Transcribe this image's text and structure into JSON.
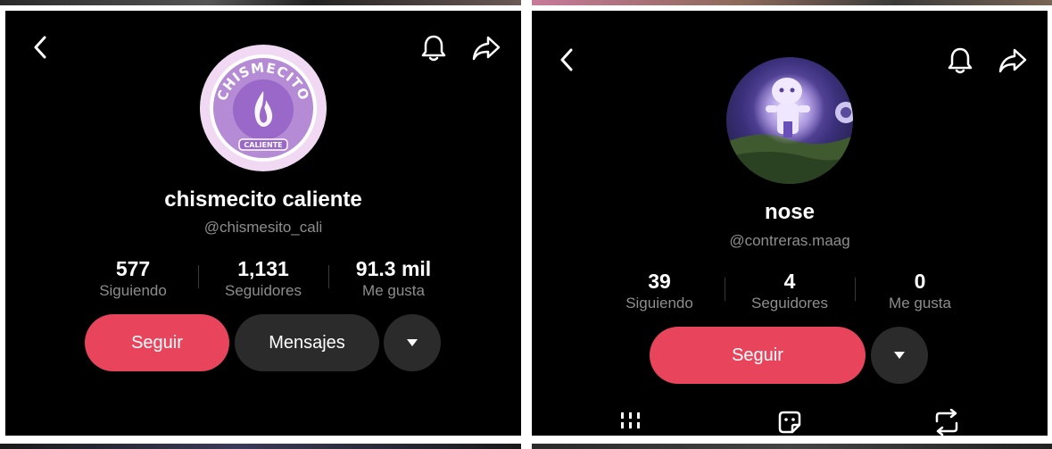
{
  "left_profile": {
    "display_name": "chismecito caliente",
    "username": "@chismesito_cali",
    "avatar_icon": "chismecito-logo",
    "logo_text_top": "CHISMECITO",
    "logo_text_bottom": "CALIENTE",
    "stats": [
      {
        "value": "577",
        "label": "Siguiendo"
      },
      {
        "value": "1,131",
        "label": "Seguidores"
      },
      {
        "value": "91.3 mil",
        "label": "Me gusta"
      }
    ],
    "follow_label": "Seguir",
    "message_label": "Mensajes"
  },
  "right_profile": {
    "display_name": "nose",
    "username": "@contreras.maag",
    "avatar_icon": "glowing-character-avatar",
    "stats": [
      {
        "value": "39",
        "label": "Siguiendo"
      },
      {
        "value": "4",
        "label": "Seguidores"
      },
      {
        "value": "0",
        "label": "Me gusta"
      }
    ],
    "follow_label": "Seguir"
  },
  "colors": {
    "accent": "#e8445c",
    "panel_bg": "#000000",
    "secondary_text": "#8e8e8e",
    "dark_button": "#2b2b2b"
  },
  "icons": [
    "back-arrow-icon",
    "bell-icon",
    "share-icon",
    "dropdown-caret-icon",
    "grid-icon",
    "sticker-icon",
    "repost-icon"
  ]
}
